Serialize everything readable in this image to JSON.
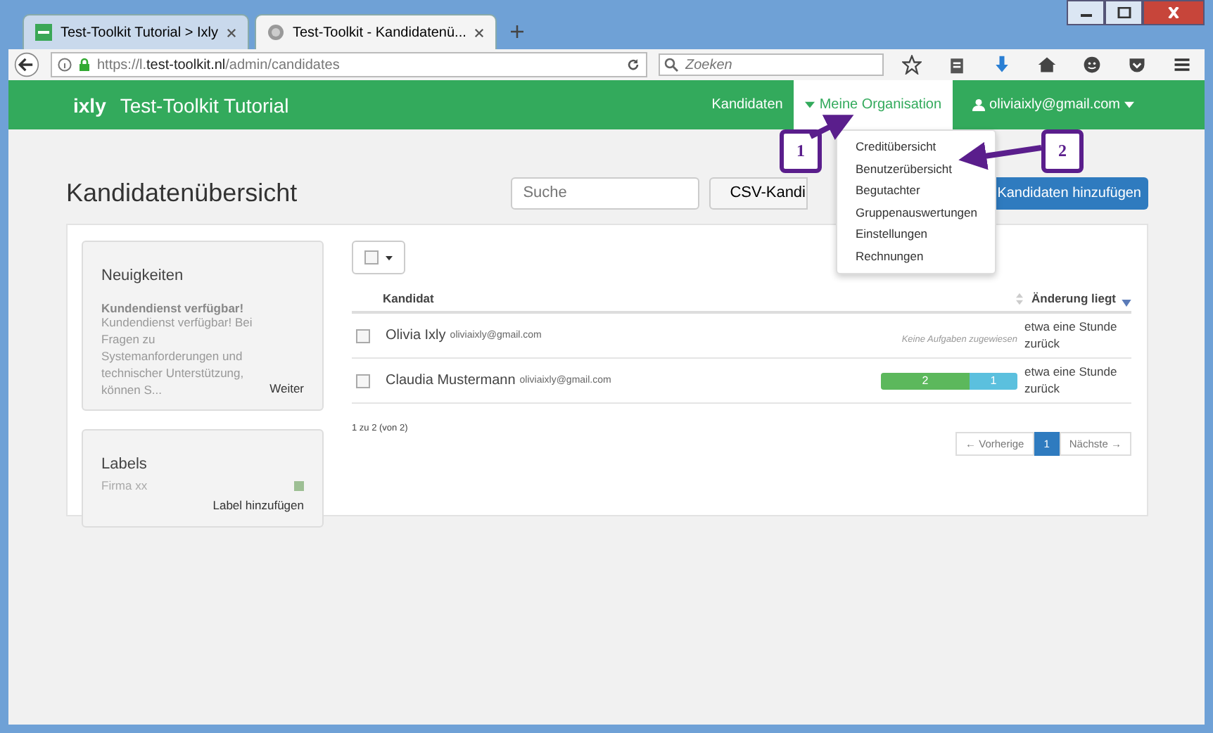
{
  "browser": {
    "tabs": [
      {
        "title": "Test-Toolkit Tutorial > Ixly",
        "selected": false
      },
      {
        "title": "Test-Toolkit - Kandidatenü...",
        "selected": true
      }
    ],
    "url": "https://l.**test-toolkit.nl**/admin/candidates",
    "search": {
      "placeholder": "Zoeken"
    }
  },
  "header": {
    "logo": "ixly",
    "title": "Test-Toolkit Tutorial",
    "nav": [
      {
        "label": "Kandidaten",
        "selected": false
      },
      {
        "label": "Meine Organisation",
        "selected": true
      }
    ],
    "user": "oliviaixly@gmail.com"
  },
  "dropdown": {
    "items": [
      "Creditübersicht",
      "Benutzerübersicht",
      "Begutachter",
      "Gruppenauswertungen",
      "Einstellungen",
      "Rechnungen"
    ]
  },
  "callouts": [
    {
      "number": "1"
    },
    {
      "number": "2"
    }
  ],
  "page": {
    "title": "Kandidatenübersicht",
    "search": {
      "placeholder": "Suche"
    },
    "csv_button": "CSV-Kandi",
    "add_button": "Kandidaten hinzufügen"
  },
  "news": {
    "title": "Neuigkeiten",
    "headline": "Kundendienst verfügbar!",
    "body": "Kundendienst verfügbar! Bei Fragen zu Systemanforderungen und technischer Unterstützung, können S...",
    "link": "Weiter"
  },
  "labels": {
    "title": "Labels",
    "items": [
      {
        "name": "Firma xx",
        "color": "#9dbf94"
      }
    ],
    "add": "Label hinzufügen"
  },
  "table": {
    "select_all": {
      "checked": false
    },
    "columns": [
      "Kandidat",
      "Änderung liegt"
    ],
    "rows": [
      {
        "name": "Olivia Ixly",
        "email": "oliviaixly@gmail.com",
        "checked": false,
        "tasks": {
          "kind": "text",
          "text": "Keine Aufgaben zugewiesen"
        },
        "changed": "etwa eine Stunde zurück"
      },
      {
        "name": "Claudia Mustermann",
        "email": "oliviaixly@gmail.com",
        "checked": false,
        "tasks": {
          "kind": "progress",
          "segments": [
            {
              "value": "2",
              "level": 0.65,
              "color": "#5cb85c"
            },
            {
              "value": "1",
              "level": 0.35,
              "color": "#5bc0de"
            }
          ]
        },
        "changed": "etwa eine Stunde zurück"
      }
    ]
  },
  "pagination": {
    "summary": "1 zu 2 (von 2)",
    "previous": "← Vorherige",
    "pages": [
      {
        "label": "1",
        "selected": true
      }
    ],
    "next": "Nächste →"
  }
}
